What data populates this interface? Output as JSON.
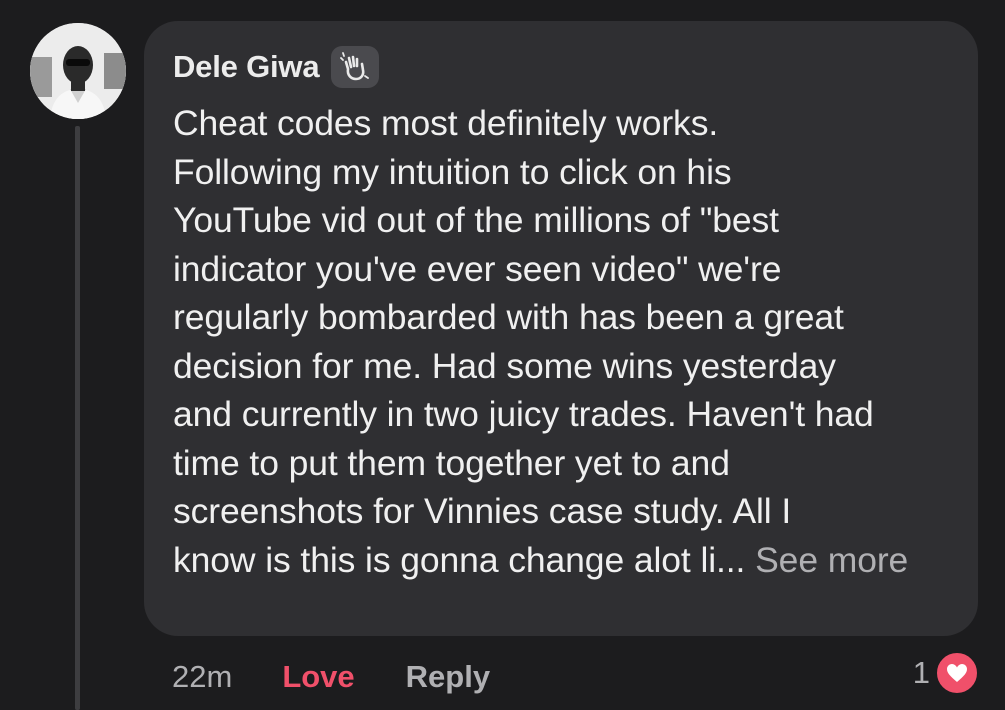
{
  "comment": {
    "author": "Dele Giwa",
    "badge_icon": "waving-hand-icon",
    "text_lines": [
      "Cheat codes most definitely works.",
      "Following my intuition to click on his",
      "YouTube vid out of the millions of \"best",
      "indicator you've ever seen video\" we're",
      "regularly bombarded with has been a great",
      "decision for me. Had some wins yesterday",
      "and currently in two juicy trades. Haven't had",
      "time to put them together yet to and",
      "screenshots for Vinnies case study. All I",
      "know is this is gonna change alot li..."
    ],
    "see_more": "See more"
  },
  "actions": {
    "timestamp": "22m",
    "love_label": "Love",
    "reply_label": "Reply"
  },
  "reactions": {
    "count": "1",
    "icon": "heart-icon"
  },
  "colors": {
    "background": "#1c1c1e",
    "bubble": "#2f2f32",
    "love_accent": "#f0506a",
    "muted_text": "#b0b0b3"
  }
}
